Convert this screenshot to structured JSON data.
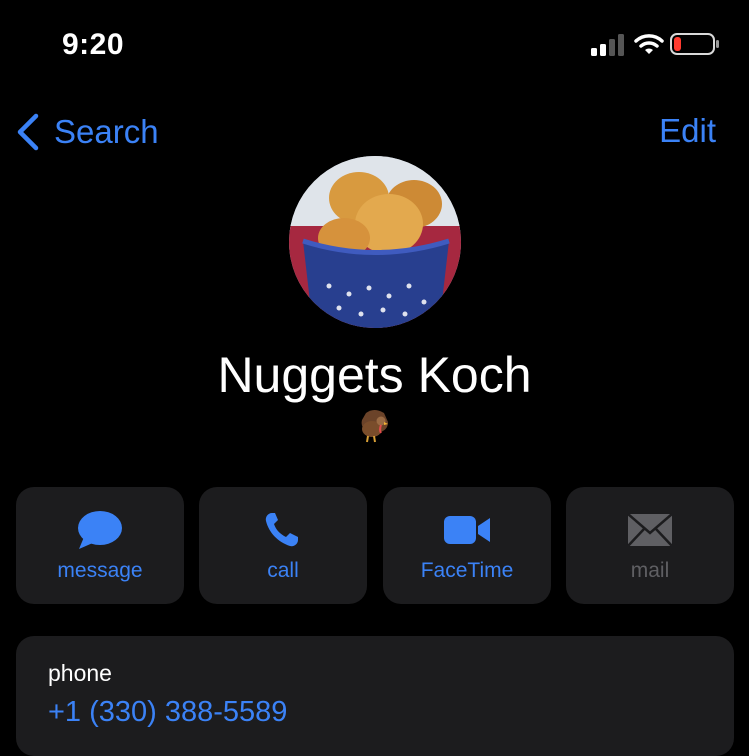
{
  "status_bar": {
    "time": "9:20",
    "signal_icon": "cellular-signal-icon",
    "wifi_icon": "wifi-icon",
    "battery_icon": "battery-low-icon",
    "battery_level_fraction": 0.15
  },
  "nav": {
    "back_label": "Search",
    "back_icon": "chevron-left-icon",
    "edit_label": "Edit"
  },
  "contact": {
    "name": "Nuggets Koch",
    "emoji": "🦃"
  },
  "actions": [
    {
      "label": "message",
      "icon": "message-bubble-icon",
      "enabled": true
    },
    {
      "label": "call",
      "icon": "phone-icon",
      "enabled": true
    },
    {
      "label": "FaceTime",
      "icon": "video-camera-icon",
      "enabled": true
    },
    {
      "label": "mail",
      "icon": "envelope-icon",
      "enabled": false
    }
  ],
  "phone": {
    "label": "phone",
    "number": "+1 (330) 388-5589"
  },
  "colors": {
    "accent": "#3b82f6",
    "card": "#1c1c1e",
    "background": "#000000",
    "disabled": "#5f5f63",
    "battery_low": "#ff3b30"
  }
}
